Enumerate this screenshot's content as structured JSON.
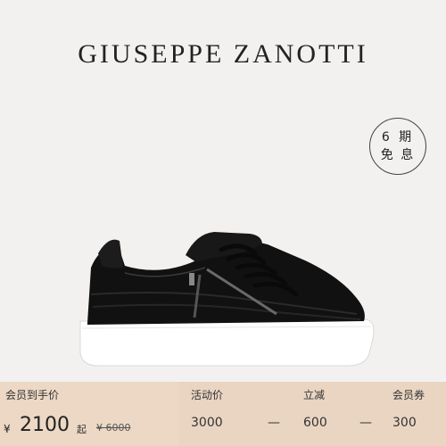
{
  "brand": "GIUSEPPE ZANOTTI",
  "badge": {
    "line1": "6 期",
    "line2": "免 息"
  },
  "bar": {
    "member_label": "会员到手价",
    "currency": "¥",
    "member_price": "2100",
    "from_label": "起",
    "original_price": "¥ 6000",
    "promo": {
      "label": "活动价",
      "value": "3000"
    },
    "op_minus_1": "—",
    "discount": {
      "label": "立减",
      "value": "600"
    },
    "op_minus_2": "—",
    "coupon": {
      "label": "会员券",
      "value": "300"
    }
  },
  "colors": {
    "bar_left": "#ecd8c4",
    "bar_right": "#ead5c2",
    "background": "#f3f1ef"
  }
}
